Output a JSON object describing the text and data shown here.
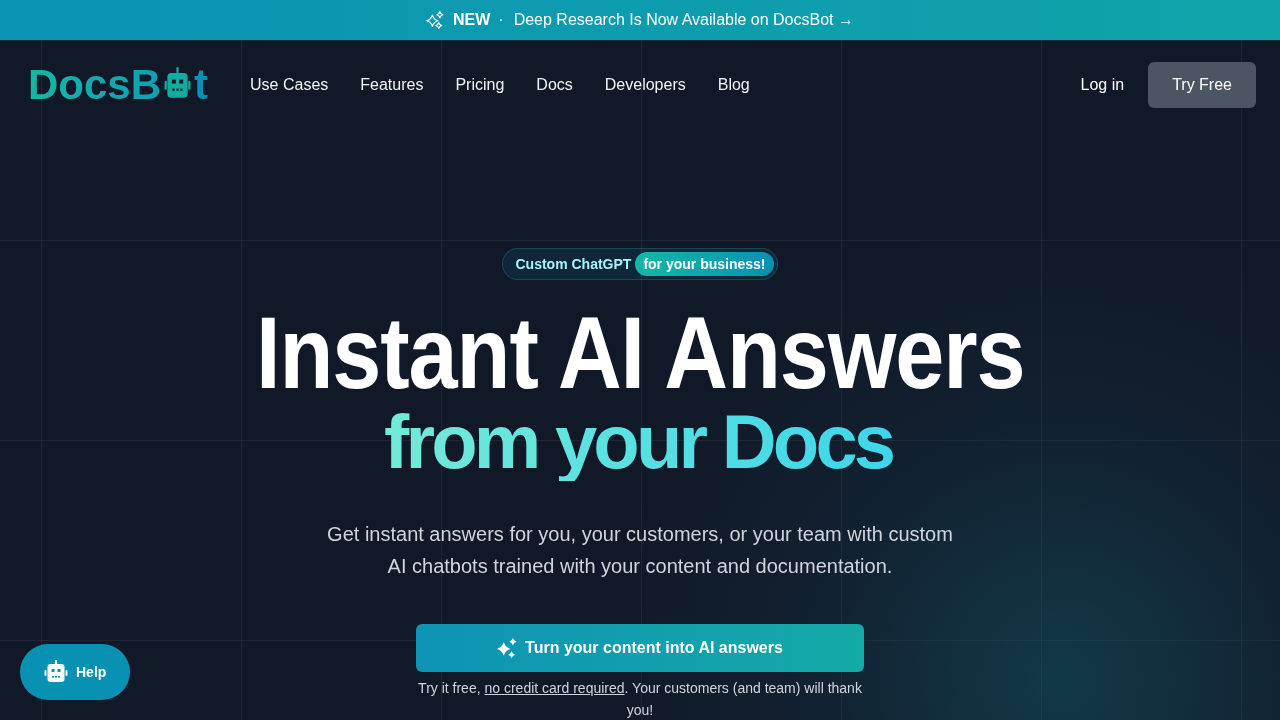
{
  "announcement": {
    "label": "NEW",
    "separator": "·",
    "link": "Deep Research Is Now Available on DocsBot →"
  },
  "header": {
    "logo": {
      "start": "DocsB",
      "end": "t"
    },
    "nav": [
      "Use Cases",
      "Features",
      "Pricing",
      "Docs",
      "Developers",
      "Blog"
    ],
    "login": "Log in",
    "cta": "Try Free"
  },
  "hero": {
    "tagline": "Custom ChatGPT",
    "tagline_highlight": "for your business!",
    "title": "Instant AI Answers",
    "title_highlight": "from your Docs",
    "description": "Get instant answers for you, your customers, or your team with custom AI chatbots trained with your content and documentation.",
    "button": "Turn your content into AI answers",
    "note": {
      "before": "Try it free, ",
      "link": "no credit card required",
      "after": ". Your customers (and team) will thank you!"
    }
  },
  "help_button": "Help"
}
